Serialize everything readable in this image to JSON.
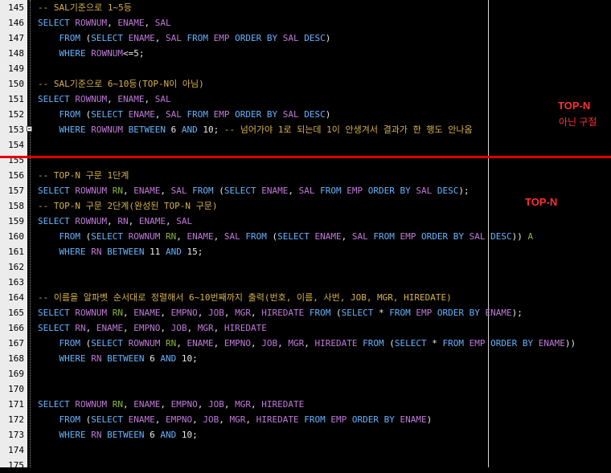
{
  "editor": {
    "lines": [
      {
        "num": "145",
        "text": "-- SAL기준으로 1~5등"
      },
      {
        "num": "146",
        "text": "SELECT ROWNUM, ENAME, SAL"
      },
      {
        "num": "147",
        "text": "    FROM (SELECT ENAME, SAL FROM EMP ORDER BY SAL DESC)"
      },
      {
        "num": "148",
        "text": "    WHERE ROWNUM<=5;"
      },
      {
        "num": "149",
        "text": ""
      },
      {
        "num": "150",
        "text": "-- SAL기준으로 6~10등(TOP-N이 아님)"
      },
      {
        "num": "151",
        "text": "SELECT ROWNUM, ENAME, SAL"
      },
      {
        "num": "152",
        "text": "    FROM (SELECT ENAME, SAL FROM EMP ORDER BY SAL DESC)"
      },
      {
        "num": "153",
        "text": "    WHERE ROWNUM BETWEEN 6 AND 10; -- 넘어가야 1로 되는데 1이 안생겨서 결과가 한 행도 안나옴"
      },
      {
        "num": "154",
        "text": ""
      },
      {
        "num": "155",
        "text": ""
      },
      {
        "num": "156",
        "text": "-- TOP-N 구문 1단계"
      },
      {
        "num": "157",
        "text": "SELECT ROWNUM RN, ENAME, SAL FROM (SELECT ENAME, SAL FROM EMP ORDER BY SAL DESC);"
      },
      {
        "num": "158",
        "text": "-- TOP-N 구문 2단계(완성된 TOP-N 구문)"
      },
      {
        "num": "159",
        "text": "SELECT ROWNUM, RN, ENAME, SAL"
      },
      {
        "num": "160",
        "text": "    FROM (SELECT ROWNUM RN, ENAME, SAL FROM (SELECT ENAME, SAL FROM EMP ORDER BY SAL DESC)) A"
      },
      {
        "num": "161",
        "text": "    WHERE RN BETWEEN 11 AND 15;"
      },
      {
        "num": "162",
        "text": ""
      },
      {
        "num": "163",
        "text": ""
      },
      {
        "num": "164",
        "text": "-- 이름을 알파벳 순서대로 정렬해서 6~10번째까지 출력(번호, 이름, 사번, JOB, MGR, HIREDATE)"
      },
      {
        "num": "165",
        "text": "SELECT ROWNUM RN, ENAME, EMPNO, JOB, MGR, HIREDATE FROM (SELECT * FROM EMP ORDER BY ENAME);"
      },
      {
        "num": "166",
        "text": "SELECT RN, ENAME, EMPNO, JOB, MGR, HIREDATE"
      },
      {
        "num": "167",
        "text": "    FROM (SELECT ROWNUM RN, ENAME, EMPNO, JOB, MGR, HIREDATE FROM (SELECT * FROM EMP ORDER BY ENAME))"
      },
      {
        "num": "168",
        "text": "    WHERE RN BETWEEN 6 AND 10;"
      },
      {
        "num": "169",
        "text": ""
      },
      {
        "num": "170",
        "text": ""
      },
      {
        "num": "171",
        "text": "SELECT ROWNUM RN, ENAME, EMPNO, JOB, MGR, HIREDATE"
      },
      {
        "num": "172",
        "text": "    FROM (SELECT ENAME, EMPNO, JOB, MGR, HIREDATE FROM EMP ORDER BY ENAME)"
      },
      {
        "num": "173",
        "text": "    WHERE RN BETWEEN 6 AND 10;"
      },
      {
        "num": "174",
        "text": ""
      },
      {
        "num": "175",
        "text": ""
      }
    ]
  },
  "annotations": {
    "top_title": "TOP-N",
    "top_sub": "아닌 구절",
    "mid_title": "TOP-N"
  },
  "colors": {
    "background": "#000000",
    "gutter": "#ececec",
    "comment": "#d6b24c",
    "keyword": "#66b3ff",
    "identifier": "#bf7ad8",
    "alias": "#8cb43c",
    "annotation": "#ff3030",
    "divider": "#e00000"
  }
}
